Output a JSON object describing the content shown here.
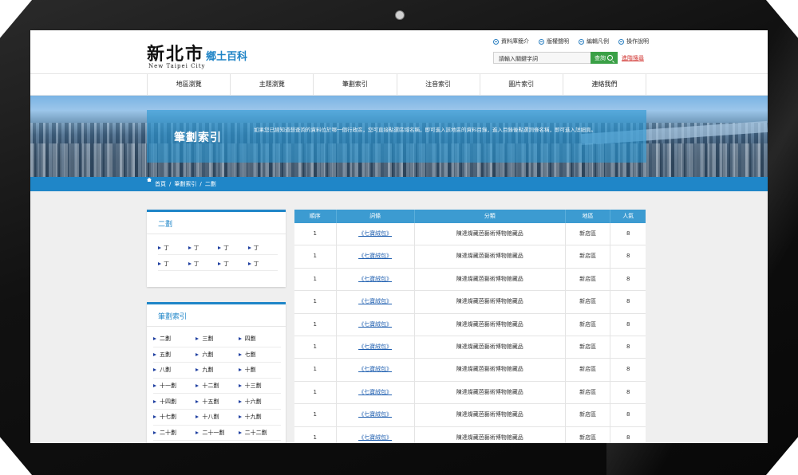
{
  "header": {
    "logo_main": "新北市",
    "logo_sub": "New Taipei City",
    "logo_tag": "鄉土百科",
    "top_links": [
      "資料庫簡介",
      "版權聲明",
      "編輯凡例",
      "操作說明"
    ],
    "search_placeholder": "請輸入關鍵字詞",
    "search_button": "查詢",
    "advanced_search": "進階搜尋"
  },
  "nav": [
    "地區瀏覽",
    "主題瀏覽",
    "筆劃索引",
    "注音索引",
    "圖片索引",
    "連絡我們"
  ],
  "banner": {
    "title": "筆劃索引",
    "description": "如果您已經知道想查詢的資料位於哪一個行政區，您可直接點選區域名稱，即可進入該地區的資料目錄，進入目錄後點選詞條名稱，即可進入詳細頁。"
  },
  "breadcrumb": [
    "首頁",
    "/",
    "筆劃索引",
    "/",
    "二劃"
  ],
  "panel_current": {
    "title": "二劃",
    "items": [
      "丁",
      "丁",
      "丁",
      "丁",
      "丁",
      "丁",
      "丁",
      "丁"
    ]
  },
  "panel_strokes": {
    "title": "筆劃索引",
    "items": [
      "二劃",
      "三劃",
      "四劃",
      "五劃",
      "六劃",
      "七劃",
      "八劃",
      "九劃",
      "十劃",
      "十一劃",
      "十二劃",
      "十三劃",
      "十四劃",
      "十五劃",
      "十六劃",
      "十七劃",
      "十八劃",
      "十九劃",
      "二十劃",
      "二十一劃",
      "二十二劃"
    ]
  },
  "table": {
    "headers": [
      "順序",
      "詞條",
      "分類",
      "地區",
      "人氣"
    ],
    "rows": [
      [
        "1",
        "《七寶絨包》",
        "陳達燦藏芭藝術博物館藏品",
        "新店區",
        "8"
      ],
      [
        "1",
        "《七寶絨包》",
        "陳達燦藏芭藝術博物館藏品",
        "新店區",
        "8"
      ],
      [
        "1",
        "《七寶絨包》",
        "陳達燦藏芭藝術博物館藏品",
        "新店區",
        "8"
      ],
      [
        "1",
        "《七寶絨包》",
        "陳達燦藏芭藝術博物館藏品",
        "新店區",
        "8"
      ],
      [
        "1",
        "《七寶絨包》",
        "陳達燦藏芭藝術博物館藏品",
        "新店區",
        "8"
      ],
      [
        "1",
        "《七寶絨包》",
        "陳達燦藏芭藝術博物館藏品",
        "新店區",
        "8"
      ],
      [
        "1",
        "《七寶絨包》",
        "陳達燦藏芭藝術博物館藏品",
        "新店區",
        "8"
      ],
      [
        "1",
        "《七寶絨包》",
        "陳達燦藏芭藝術博物館藏品",
        "新店區",
        "8"
      ],
      [
        "1",
        "《七寶絨包》",
        "陳達燦藏芭藝術博物館藏品",
        "新店區",
        "8"
      ],
      [
        "1",
        "《七寶絨包》",
        "陳達燦藏芭藝術博物館藏品",
        "新店區",
        "8"
      ]
    ]
  },
  "colors": {
    "accent": "#1f86c8",
    "table_header": "#3c9bd1",
    "search_button": "#3aa046",
    "advanced_link": "#d0312d"
  }
}
